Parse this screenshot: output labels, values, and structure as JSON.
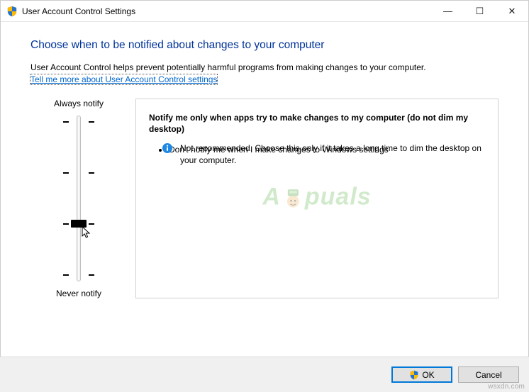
{
  "window": {
    "title": "User Account Control Settings",
    "controls": {
      "min": "—",
      "max": "☐",
      "close": "✕"
    }
  },
  "heading": "Choose when to be notified about changes to your computer",
  "description": "User Account Control helps prevent potentially harmful programs from making changes to your computer.",
  "help_link": "Tell me more about User Account Control settings",
  "slider": {
    "top_label": "Always notify",
    "bottom_label": "Never notify",
    "levels": 4,
    "current_level_index_from_top": 2
  },
  "panel": {
    "title": "Notify me only when apps try to make changes to my computer (do not dim my desktop)",
    "bullets": [
      "Don't notify me when I make changes to Windows settings"
    ],
    "footnote": "Not recommended. Choose this only if it takes a long time to dim the desktop on your computer."
  },
  "buttons": {
    "ok": "OK",
    "cancel": "Cancel"
  },
  "watermark": {
    "prefix": "A",
    "suffix": "puals"
  },
  "credit": "wsxdn.com",
  "colors": {
    "heading": "#003399",
    "link": "#0066cc",
    "accent": "#0078d7"
  }
}
